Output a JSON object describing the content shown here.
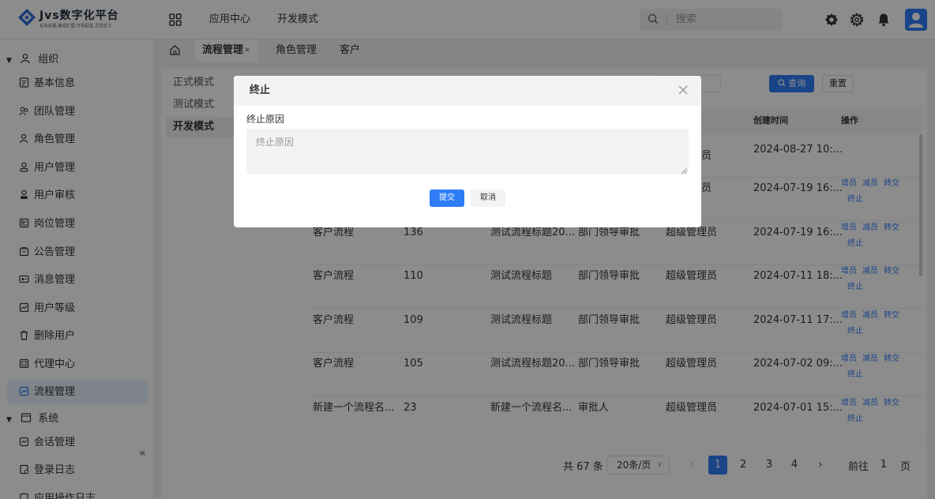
{
  "header": {
    "logo_title": "Jvs数字化平台",
    "logo_subtitle": "私有部署,集成扩展,可视配置,灵活定义",
    "nav": [
      "应用中心",
      "开发模式"
    ],
    "search_placeholder": "搜索",
    "icons": [
      "apps-grid-icon",
      "search-icon",
      "settings-icon",
      "gear-icon",
      "bell-icon",
      "user-avatar-icon"
    ]
  },
  "sidebar": {
    "groups": [
      {
        "label": "组织",
        "icon": "users-icon"
      },
      {
        "label": "系统",
        "icon": "window-icon"
      }
    ],
    "items": [
      {
        "label": "基本信息",
        "icon": "document-icon"
      },
      {
        "label": "团队管理",
        "icon": "team-icon"
      },
      {
        "label": "角色管理",
        "icon": "role-icon"
      },
      {
        "label": "用户管理",
        "icon": "user-icon"
      },
      {
        "label": "用户审核",
        "icon": "user-check-icon"
      },
      {
        "label": "岗位管理",
        "icon": "post-icon"
      },
      {
        "label": "公告管理",
        "icon": "notice-icon"
      },
      {
        "label": "消息管理",
        "icon": "message-icon"
      },
      {
        "label": "用户等级",
        "icon": "chart-icon"
      },
      {
        "label": "删除用户",
        "icon": "trash-icon"
      },
      {
        "label": "代理中心",
        "icon": "proxy-icon"
      },
      {
        "label": "流程管理",
        "icon": "flow-icon"
      },
      {
        "label": "会话管理",
        "icon": "session-icon"
      },
      {
        "label": "登录日志",
        "icon": "log-icon"
      },
      {
        "label": "应用操作日志",
        "icon": "log-icon"
      }
    ],
    "active_item": "流程管理",
    "collapse_label": "«"
  },
  "tabs": {
    "items": [
      "流程管理",
      "角色管理",
      "客户"
    ],
    "active": "流程管理",
    "close": "×"
  },
  "modes": [
    "正式模式",
    "测试模式",
    "开发模式"
  ],
  "active_mode": "开发模式",
  "filters": {
    "query_label": "查询",
    "reset_label": "重置"
  },
  "table": {
    "headers": {
      "created": "创建时间",
      "ops": "操作"
    },
    "rows": [
      {
        "type": "",
        "id": "",
        "title": "",
        "node": "",
        "user": "员",
        "created": "2024-08-27 10:...",
        "ops": []
      },
      {
        "type": "",
        "id": "",
        "title": "",
        "node": "",
        "user": "员",
        "created": "2024-07-19 16:...",
        "ops": [
          "增员",
          "减员",
          "转交",
          "终止"
        ]
      },
      {
        "type": "客户流程",
        "id": "136",
        "title": "测试流程标题20...",
        "node": "部门领导审批",
        "user": "超级管理员",
        "created": "2024-07-19 16:...",
        "ops": [
          "增员",
          "减员",
          "转交",
          "终止"
        ]
      },
      {
        "type": "客户流程",
        "id": "110",
        "title": "测试流程标题",
        "node": "部门领导审批",
        "user": "超级管理员",
        "created": "2024-07-11 18:...",
        "ops": [
          "增员",
          "减员",
          "转交",
          "终止"
        ]
      },
      {
        "type": "客户流程",
        "id": "109",
        "title": "测试流程标题",
        "node": "部门领导审批",
        "user": "超级管理员",
        "created": "2024-07-11 17:...",
        "ops": [
          "增员",
          "减员",
          "转交",
          "终止"
        ]
      },
      {
        "type": "客户流程",
        "id": "105",
        "title": "测试流程标题20...",
        "node": "部门领导审批",
        "user": "超级管理员",
        "created": "2024-07-02 09:...",
        "ops": [
          "增员",
          "减员",
          "转交",
          "终止"
        ]
      },
      {
        "type": "新建一个流程名...",
        "id": "23",
        "title": "新建一个流程名...",
        "node": "审批人",
        "user": "超级管理员",
        "created": "2024-07-01 15:...",
        "ops": [
          "增员",
          "减员",
          "转交",
          "终止"
        ]
      }
    ]
  },
  "pagination": {
    "total": "共 67 条",
    "page_size": "20条/页",
    "pages": [
      "1",
      "2",
      "3",
      "4"
    ],
    "current": "1",
    "goto_label": "前往",
    "goto_value": "1",
    "goto_unit": "页"
  },
  "modal": {
    "title": "终止",
    "field_label": "终止原因",
    "placeholder": "终止原因",
    "submit": "提交",
    "cancel": "取消"
  },
  "colors": {
    "accent": "#2e7cf6",
    "overlay": "rgba(0,0,0,0.45)"
  }
}
